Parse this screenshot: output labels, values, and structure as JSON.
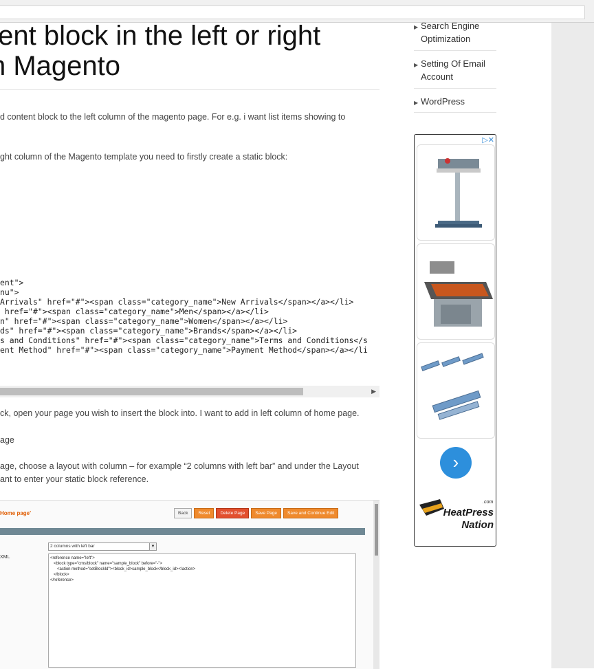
{
  "article": {
    "title_line1": "tent block in the left or right",
    "title_line2": "n Magento",
    "para1": "d content block to the left column of the magento page. For e.g. i want list items showing to",
    "para2": "ght column of the Magento template you need to firstly create a static block:",
    "code_lines": [
      "ent\">",
      "nu\">",
      "Arrivals\" href=\"#\"><span class=\"category_name\">New Arrivals</span></a></li>",
      " href=\"#\"><span class=\"category_name\">Men</span></a></li>",
      "n\" href=\"#\"><span class=\"category_name\">Women</span></a></li>",
      "ds\" href=\"#\"><span class=\"category_name\">Brands</span></a></li>",
      "s and Conditions\" href=\"#\"><span class=\"category_name\">Terms and Conditions</s",
      "ent Method\" href=\"#\"><span class=\"category_name\">Payment Method</span></a></li"
    ],
    "para3": "ck, open your page you wish to insert the block into. I want to add in left column of home page.",
    "para4": "age",
    "para5a": "age, choose a layout with column – for example “2 columns with left bar” and under the Layout",
    "para5b": "ant to enter your static block reference."
  },
  "screenshot": {
    "page_title": "Home page'",
    "buttons": {
      "back": "Back",
      "reset": "Reset",
      "delete": "Delete Page",
      "save": "Save Page",
      "save_continue": "Save and Continue Edit"
    },
    "layout_select": "2 columns with left bar",
    "xml_label": "XML",
    "xml_text": "<reference name=\"left\">\n   <block type=\"cms/block\" name=\"sample_block\" before=\"-\">\n      <action method=\"setBlockId\"><block_id>sample_block</block_id></action>\n   </block>\n</reference>"
  },
  "sidebar": {
    "items": [
      {
        "label": "Search Engine Optimization"
      },
      {
        "label": "Setting Of Email Account"
      },
      {
        "label": "WordPress"
      }
    ]
  },
  "ad": {
    "adchoices": "▷✕",
    "logo_top": ".com",
    "logo_main": "HeatPress",
    "logo_sub": "Nation",
    "next_symbol": "›"
  }
}
